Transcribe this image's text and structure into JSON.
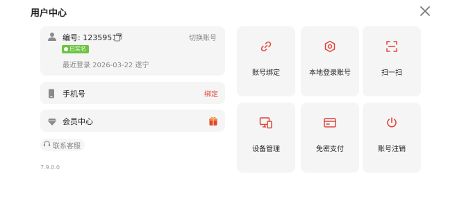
{
  "header": {
    "title": "用户中心"
  },
  "user": {
    "id_label": "编号: 12359517",
    "switch_label": "切换账号",
    "verified_badge": "已实名",
    "last_login": "最近登录 2026-03-22 遂宁"
  },
  "phone": {
    "label": "手机号",
    "action": "绑定"
  },
  "vip": {
    "label": "会员中心"
  },
  "support": {
    "label": "联系客服"
  },
  "version": "7.9.0.0",
  "tiles": [
    {
      "label": "账号绑定",
      "icon": "link-icon"
    },
    {
      "label": "本地登录账号",
      "icon": "hexagon-gear-icon"
    },
    {
      "label": "扫一扫",
      "icon": "scan-icon"
    },
    {
      "label": "设备管理",
      "icon": "devices-icon"
    },
    {
      "label": "免密支付",
      "icon": "card-icon"
    },
    {
      "label": "账号注销",
      "icon": "power-icon"
    }
  ],
  "colors": {
    "accent": "#e0453a",
    "verified": "#6cc43f",
    "card_bg": "#f5f5f5"
  }
}
